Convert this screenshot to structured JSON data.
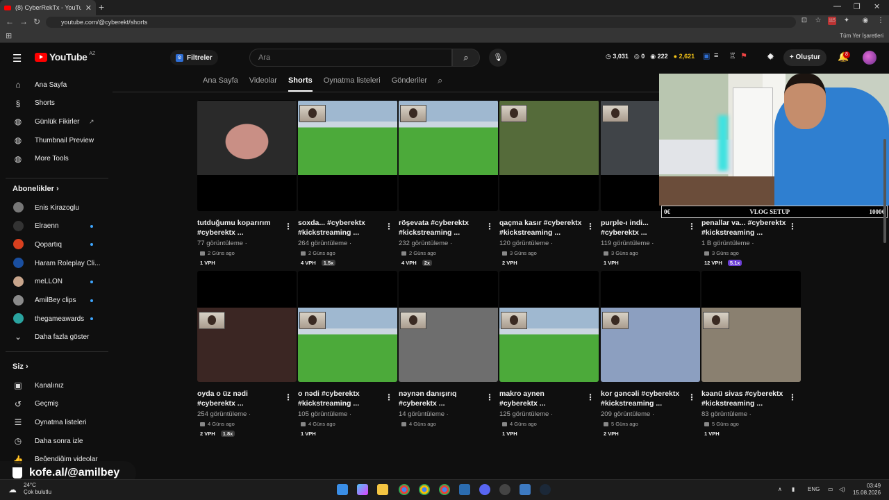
{
  "browser": {
    "tab_title": "(8) CyberRekTx - YouTube",
    "url": "youtube.com/@cyberekt/shorts",
    "all_bookmarks": "Tüm Yer İşaretleri",
    "ext_badge": "115"
  },
  "header": {
    "logo_text": "YouTube",
    "country": "AZ",
    "filter_label": "Filtreler",
    "search_placeholder": "Ara",
    "stats": [
      "3,031",
      "0",
      "222",
      "2,621"
    ],
    "create_label": "Oluştur",
    "notif_count": "8"
  },
  "sidebar": {
    "main": [
      {
        "icon": "home-icon",
        "label": "Ana Sayfa"
      },
      {
        "icon": "shorts-icon",
        "label": "Shorts"
      },
      {
        "icon": "ext-icon",
        "label": "Günlük Fikirler"
      },
      {
        "icon": "ext-icon",
        "label": "Thumbnail Preview"
      },
      {
        "icon": "ext-icon",
        "label": "More Tools"
      }
    ],
    "subs_title": "Abonelikler",
    "subs": [
      {
        "label": "Enis Kirazoglu",
        "color": "#777",
        "dot": false
      },
      {
        "label": "Elraenn",
        "color": "#333",
        "dot": true
      },
      {
        "label": "Qopartıq",
        "color": "#d8401f",
        "dot": true
      },
      {
        "label": "Haram Roleplay Cli...",
        "color": "#1a4fa0",
        "dot": false
      },
      {
        "label": "meLLON",
        "color": "#c8a58c",
        "dot": true
      },
      {
        "label": "AmilBey clips",
        "color": "#8a8a8a",
        "dot": true
      },
      {
        "label": "thegameawards",
        "color": "#2aa4a0",
        "dot": true
      }
    ],
    "more": "Daha fazla göster",
    "you_title": "Siz",
    "you": [
      {
        "icon": "channel-icon",
        "label": "Kanalınız"
      },
      {
        "icon": "history-icon",
        "label": "Geçmiş"
      },
      {
        "icon": "playlist-icon",
        "label": "Oynatma listeleri"
      },
      {
        "icon": "clock-icon",
        "label": "Daha sonra izle"
      },
      {
        "icon": "like-icon",
        "label": "Beğendiğim videolar"
      }
    ]
  },
  "channel_tabs": [
    "Ana Sayfa",
    "Videolar",
    "Shorts",
    "Oynatma listeleri",
    "Gönderiler"
  ],
  "shorts": [
    {
      "t1": "tutduğumu koparırım",
      "t2": "#cyberektx ...",
      "views": "77 görüntüleme ·",
      "ago": "2 Güns ago",
      "vph": "1 VPH",
      "mult": "",
      "mc": "",
      "thumb": "face"
    },
    {
      "t1": "soxda...  #cyberektx",
      "t2": "#kickstreaming ...",
      "views": "264 görüntüleme ·",
      "ago": "2 Güns ago",
      "vph": "4 VPH",
      "mult": "1.5x",
      "mc": "#3a3a3a",
      "thumb": "field"
    },
    {
      "t1": "röşevata  #cyberektx",
      "t2": "#kickstreaming ...",
      "views": "232 görüntüleme ·",
      "ago": "2 Güns ago",
      "vph": "4 VPH",
      "mult": "2x",
      "mc": "#3a3a3a",
      "thumb": "field"
    },
    {
      "t1": "qaçma kasır  #cyberektx",
      "t2": "#kickstreaming ...",
      "views": "120 görüntüleme ·",
      "ago": "3 Güns ago",
      "vph": "2 VPH",
      "mult": "",
      "mc": "",
      "thumb": "red"
    },
    {
      "t1": "purple-ı indi...",
      "t2": "#cyberektx ...",
      "views": "119 görüntüleme ·",
      "ago": "3 Güns ago",
      "vph": "1 VPH",
      "mult": "",
      "mc": "",
      "thumb": "dark"
    },
    {
      "t1": "penallar va... #cyberektx",
      "t2": "#kickstreaming ...",
      "views": "1 B görüntüleme ·",
      "ago": "3 Güns ago",
      "vph": "12 VPH",
      "mult": "5.1x",
      "mc": "#6c3fd6",
      "thumb": "none"
    },
    {
      "t1": "oyda o üz nədi",
      "t2": "#cyberektx ...",
      "views": "254 görüntüleme ·",
      "ago": "4 Güns ago",
      "vph": "2 VPH",
      "mult": "1.8x",
      "mc": "#3a3a3a",
      "thumb": "game"
    },
    {
      "t1": "o nədi  #cyberektx",
      "t2": "#kickstreaming ...",
      "views": "105 görüntüleme ·",
      "ago": "4 Güns ago",
      "vph": "1 VPH",
      "mult": "",
      "mc": "",
      "thumb": "field"
    },
    {
      "t1": "nəynən danışırıq",
      "t2": "#cyberektx ...",
      "views": "14 görüntüleme ·",
      "ago": "4 Güns ago",
      "vph": "",
      "mult": "",
      "mc": "",
      "thumb": "car"
    },
    {
      "t1": "makro aynen",
      "t2": "#cyberektx ...",
      "views": "125 görüntüleme ·",
      "ago": "4 Güns ago",
      "vph": "1 VPH",
      "mult": "",
      "mc": "",
      "thumb": "field"
    },
    {
      "t1": "kor gəncəli  #cyberektx",
      "t2": "#kickstreaming ...",
      "views": "209 görüntüleme ·",
      "ago": "5 Güns ago",
      "vph": "2 VPH",
      "mult": "",
      "mc": "",
      "thumb": "blue"
    },
    {
      "t1": "kəanü sivas  #cyberektx",
      "t2": "#kickstreaming ...",
      "views": "83 görüntüleme ·",
      "ago": "5 Güns ago",
      "vph": "1 VPH",
      "mult": "",
      "mc": "",
      "thumb": "people"
    }
  ],
  "overlay": {
    "left": "0€",
    "center": "VLOG SETUP",
    "right": "1000€",
    "kofe": "kofe.al/@amilbey"
  },
  "taskbar": {
    "temp": "24°C",
    "weather": "Çok bulutlu",
    "lang": "ENG",
    "time": "03:49",
    "date": "15.08.2026"
  }
}
